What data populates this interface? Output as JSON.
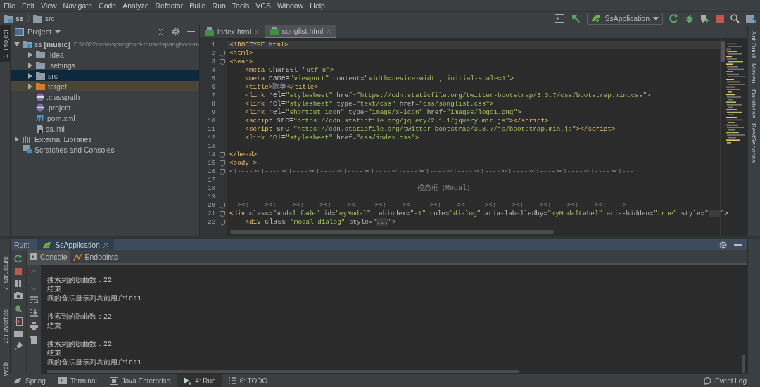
{
  "menu": [
    "File",
    "Edit",
    "View",
    "Navigate",
    "Code",
    "Analyze",
    "Refactor",
    "Build",
    "Run",
    "Tools",
    "VCS",
    "Window",
    "Help"
  ],
  "breadcrumb": [
    "ss",
    "src"
  ],
  "run_config": "SsApplication",
  "left_tool_windows": [
    {
      "label": "1: Project",
      "selected": true
    }
  ],
  "left_tool_windows_bottom": [
    {
      "label": "7: Structure"
    },
    {
      "label": "2: Favorites"
    },
    {
      "label": "Web"
    }
  ],
  "right_tool_windows": [
    "Ant Build",
    "Maven",
    "Database",
    "RestServices"
  ],
  "project": {
    "title": "Project",
    "tree": [
      {
        "name": "ss",
        "tag": "[music]",
        "path": "E:\\2022code\\springboot-music\\springboot-m",
        "kind": "module",
        "expanded": true,
        "selected": false,
        "children": [
          {
            "name": ".idea",
            "kind": "folder",
            "expanded": false,
            "selected": false
          },
          {
            "name": ".settings",
            "kind": "folder",
            "expanded": false,
            "selected": false
          },
          {
            "name": "src",
            "kind": "folder",
            "expanded": false,
            "selected": true
          },
          {
            "name": "target",
            "kind": "excluded",
            "expanded": false,
            "selected": false
          },
          {
            "name": ".classpath",
            "kind": "eclipse",
            "selected": false
          },
          {
            "name": ".project",
            "kind": "eclipse",
            "selected": false
          },
          {
            "name": "pom.xml",
            "kind": "maven",
            "selected": false
          },
          {
            "name": "ss.iml",
            "kind": "iml",
            "selected": false
          }
        ]
      },
      {
        "name": "External Libraries",
        "kind": "libraries",
        "expanded": false,
        "selected": false
      },
      {
        "name": "Scratches and Consoles",
        "kind": "scratches",
        "selected": false
      }
    ]
  },
  "editor_tabs": [
    {
      "label": "index.html",
      "selected": false
    },
    {
      "label": "songlist.html",
      "selected": true
    }
  ],
  "code": [
    {
      "number": "1",
      "kind": "plain",
      "fold": false,
      "current": true,
      "segs": [
        {
          "kind": "tag",
          "text": "<!DOCTYPE html>"
        }
      ]
    },
    {
      "number": "2",
      "kind": "plain",
      "fold": true,
      "current": false,
      "segs": [
        {
          "kind": "tag",
          "text": "<html>"
        }
      ]
    },
    {
      "number": "3",
      "kind": "plain",
      "fold": true,
      "current": false,
      "segs": [
        {
          "kind": "tag",
          "text": "<head>"
        }
      ]
    },
    {
      "number": "4",
      "kind": "indented",
      "fold": false,
      "current": false,
      "segs": [
        {
          "kind": "tag",
          "text": "<meta "
        },
        {
          "kind": "attr",
          "text": "charset="
        },
        {
          "kind": "string",
          "text": "\"utf-8\""
        },
        {
          "kind": "tag",
          "text": ">"
        }
      ]
    },
    {
      "number": "5",
      "kind": "indented",
      "fold": false,
      "current": false,
      "segs": [
        {
          "kind": "tag",
          "text": "<meta "
        },
        {
          "kind": "attr",
          "text": "name="
        },
        {
          "kind": "string",
          "text": "\"viewport\""
        },
        {
          "kind": "attr",
          "text": " content="
        },
        {
          "kind": "string",
          "text": "\"width=device-width, initial-scale=1\""
        },
        {
          "kind": "tag",
          "text": ">"
        }
      ]
    },
    {
      "number": "6",
      "kind": "indented",
      "fold": false,
      "current": false,
      "segs": [
        {
          "kind": "tag",
          "text": "<title>"
        },
        {
          "kind": "text",
          "text": "歌单"
        },
        {
          "kind": "tag",
          "text": "</title>"
        }
      ]
    },
    {
      "number": "7",
      "kind": "indented",
      "fold": false,
      "current": false,
      "segs": [
        {
          "kind": "tag",
          "text": "<link "
        },
        {
          "kind": "attr",
          "text": "rel="
        },
        {
          "kind": "string",
          "text": "\"stylesheet\""
        },
        {
          "kind": "attr",
          "text": " href="
        },
        {
          "kind": "string",
          "text": "\"https://cdn.staticfile.org/twitter-bootstrap/3.3.7/css/bootstrap.min.css\""
        },
        {
          "kind": "tag",
          "text": ">"
        }
      ]
    },
    {
      "number": "8",
      "kind": "indented",
      "fold": false,
      "current": false,
      "segs": [
        {
          "kind": "tag",
          "text": "<link "
        },
        {
          "kind": "attr",
          "text": "rel="
        },
        {
          "kind": "string",
          "text": "\"stylesheet\""
        },
        {
          "kind": "attr",
          "text": " type="
        },
        {
          "kind": "string",
          "text": "\"text/css\""
        },
        {
          "kind": "attr",
          "text": " href="
        },
        {
          "kind": "string",
          "text": "\"css/songlist.css\""
        },
        {
          "kind": "tag",
          "text": ">"
        }
      ]
    },
    {
      "number": "9",
      "kind": "indented",
      "fold": false,
      "current": false,
      "segs": [
        {
          "kind": "tag",
          "text": "<link "
        },
        {
          "kind": "attr",
          "text": "rel="
        },
        {
          "kind": "string",
          "text": "\"shortcut icon\""
        },
        {
          "kind": "attr",
          "text": " type="
        },
        {
          "kind": "string",
          "text": "\"image/x-icon\""
        },
        {
          "kind": "attr",
          "text": " href="
        },
        {
          "kind": "string",
          "text": "\"images/logo1.png\""
        },
        {
          "kind": "tag",
          "text": ">"
        }
      ]
    },
    {
      "number": "10",
      "kind": "indented",
      "fold": false,
      "current": false,
      "segs": [
        {
          "kind": "tag",
          "text": "<script "
        },
        {
          "kind": "attr",
          "text": "src="
        },
        {
          "kind": "string",
          "text": "\"https://cdn.staticfile.org/jquery/2.1.1/jquery.min.js\""
        },
        {
          "kind": "tag",
          "text": "></script>"
        }
      ]
    },
    {
      "number": "11",
      "kind": "indented",
      "fold": false,
      "current": false,
      "segs": [
        {
          "kind": "tag",
          "text": "<script "
        },
        {
          "kind": "attr",
          "text": "src="
        },
        {
          "kind": "string",
          "text": "\"https://cdn.staticfile.org/twitter-bootstrap/3.3.7/js/bootstrap.min.js\""
        },
        {
          "kind": "tag",
          "text": "></script>"
        }
      ]
    },
    {
      "number": "12",
      "kind": "indented",
      "fold": false,
      "current": false,
      "segs": [
        {
          "kind": "tag",
          "text": "<link "
        },
        {
          "kind": "attr",
          "text": "rel="
        },
        {
          "kind": "string",
          "text": "\"stylesheet\""
        },
        {
          "kind": "attr",
          "text": " href="
        },
        {
          "kind": "string",
          "text": "\"css/index.css\""
        },
        {
          "kind": "tag",
          "text": ">"
        }
      ]
    },
    {
      "number": "13",
      "kind": "plain",
      "fold": false,
      "current": false
    },
    {
      "number": "14",
      "kind": "plain",
      "fold": true,
      "current": false,
      "segs": [
        {
          "kind": "tag",
          "text": "</head>"
        }
      ]
    },
    {
      "number": "15",
      "kind": "plain",
      "fold": true,
      "current": false,
      "segs": [
        {
          "kind": "tag",
          "text": "<body >"
        }
      ]
    },
    {
      "number": "16",
      "kind": "plain",
      "fold": true,
      "current": false,
      "segs": [
        {
          "kind": "comment",
          "text": "<!----><!----><!----><!----><!----><!----><!----><!----><!----><!----><!----><!----><!----><!----><!---"
        }
      ]
    },
    {
      "number": "17",
      "kind": "plain",
      "fold": false,
      "current": false
    },
    {
      "number": "18",
      "kind": "centered",
      "fold": false,
      "current": false,
      "segs": [
        {
          "kind": "comment",
          "text": "模态框（Modal）"
        }
      ]
    },
    {
      "number": "19",
      "kind": "plain",
      "fold": false,
      "current": false
    },
    {
      "number": "20",
      "kind": "plain",
      "fold": true,
      "current": false,
      "segs": [
        {
          "kind": "comment",
          "text": "--><!----><!----><!----><!----><!----><!----><!----><!----><!----><!----><!----><!----><!----><!---->"
        }
      ]
    },
    {
      "number": "21",
      "kind": "plain",
      "fold": true,
      "current": false,
      "segs": [
        {
          "kind": "tag",
          "text": "<div "
        },
        {
          "kind": "attr",
          "text": "class="
        },
        {
          "kind": "string",
          "text": "\"modal fade\""
        },
        {
          "kind": "attr",
          "text": " id="
        },
        {
          "kind": "string",
          "text": "\"myModal\""
        },
        {
          "kind": "attr",
          "text": " tabindex="
        },
        {
          "kind": "string",
          "text": "\"-1\""
        },
        {
          "kind": "attr",
          "text": " role="
        },
        {
          "kind": "string",
          "text": "\"dialog\""
        },
        {
          "kind": "attr",
          "text": " aria-labelledby="
        },
        {
          "kind": "string",
          "text": "\"myModalLabel\""
        },
        {
          "kind": "attr",
          "text": " aria-hidden="
        },
        {
          "kind": "string",
          "text": "\"true\""
        },
        {
          "kind": "attr",
          "text": " style="
        },
        {
          "kind": "string",
          "text": "\""
        },
        {
          "kind": "folded",
          "text": "..."
        },
        {
          "kind": "string",
          "text": "\""
        },
        {
          "kind": "tag",
          "text": ">"
        }
      ]
    },
    {
      "number": "22",
      "kind": "indented",
      "fold": true,
      "current": false,
      "segs": [
        {
          "kind": "tag",
          "text": "<div "
        },
        {
          "kind": "attr",
          "text": "class="
        },
        {
          "kind": "string",
          "text": "\"modal-dialog\""
        },
        {
          "kind": "attr",
          "text": " style="
        },
        {
          "kind": "string",
          "text": "\""
        },
        {
          "kind": "folded",
          "text": "..."
        },
        {
          "kind": "string",
          "text": "\""
        },
        {
          "kind": "tag",
          "text": ">"
        }
      ]
    }
  ],
  "run": {
    "label": "Run:",
    "tab": "SsApplication",
    "subtabs": [
      {
        "label": "Console",
        "selected": true
      },
      {
        "label": "Endpoints",
        "selected": false
      }
    ],
    "console_blocks": [
      [
        "搜索到的歌曲数：22",
        "结束",
        "我的音乐显示列表前用户id:1"
      ],
      [
        "搜索到的歌曲数：22",
        "结束"
      ],
      [
        "搜索到的歌曲数：22",
        "结束",
        "我的音乐显示列表前用户id:1"
      ]
    ]
  },
  "bottom_tabs": [
    {
      "label": "Spring",
      "selected": false
    },
    {
      "label": "Terminal",
      "selected": false
    },
    {
      "label": "Java Enterprise",
      "selected": false
    },
    {
      "label": "4: Run",
      "selected": true
    },
    {
      "label": "6: TODO",
      "selected": false
    }
  ],
  "event_log": "Event Log"
}
